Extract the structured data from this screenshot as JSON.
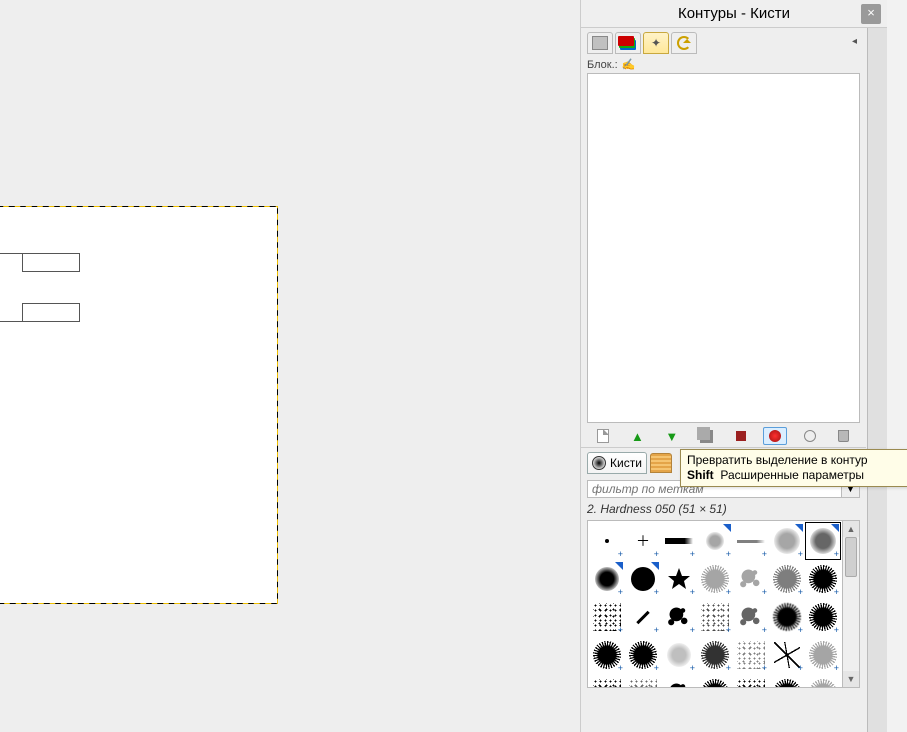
{
  "dock": {
    "title": "Контуры - Кисти",
    "close": "×"
  },
  "paths_panel": {
    "lock_label": "Блок.:"
  },
  "tooltip": {
    "line1": "Превратить выделение в контур",
    "shift": "Shift",
    "line2": "Расширенные параметры"
  },
  "brush_panel": {
    "tab_label": "Кисти",
    "filter_placeholder": "фильтр по меткам",
    "selected_brush": "2. Hardness 050 (51 × 51)"
  },
  "bottom_icons": [
    "new",
    "raise",
    "lower",
    "duplicate",
    "anchor",
    "sel-to-path",
    "stroke",
    "trash"
  ]
}
